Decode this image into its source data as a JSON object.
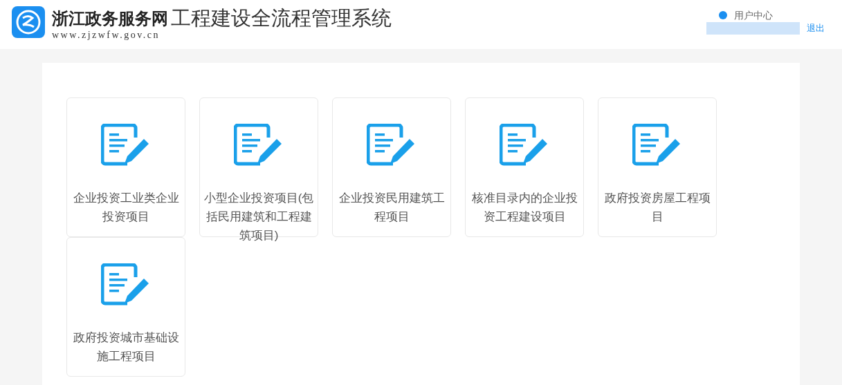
{
  "header": {
    "site_name": "浙江政务服务网",
    "system_name": "工程建设全流程管理系统",
    "url": "www.zjzwfw.gov.cn",
    "user_center": "用户中心",
    "logout": "退出"
  },
  "cards": [
    {
      "label": "企业投资工业类企业投资项目"
    },
    {
      "label": "小型企业投资项目(包括民用建筑和工程建筑项目)"
    },
    {
      "label": "企业投资民用建筑工程项目"
    },
    {
      "label": "核准目录内的企业投资工程建设项目"
    },
    {
      "label": "政府投资房屋工程项目"
    },
    {
      "label": "政府投资城市基础设施工程项目"
    }
  ]
}
